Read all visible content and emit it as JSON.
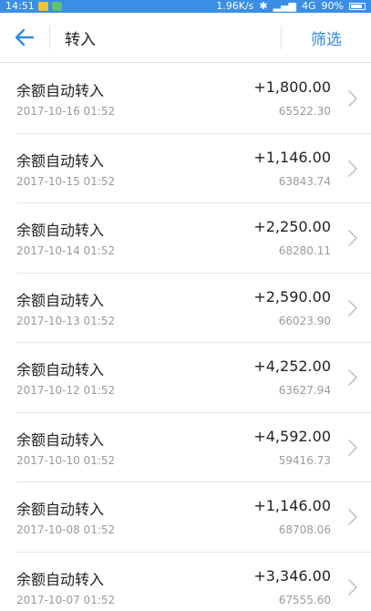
{
  "status_bar": {
    "time": "14:51",
    "net_speed": "1.96K/s",
    "network": "4G",
    "battery": "90%"
  },
  "header": {
    "title": "转入",
    "filter_label": "筛选"
  },
  "colors": {
    "accent": "#2f8ae6",
    "text": "#222222",
    "muted": "#9a9a9a"
  },
  "transactions": [
    {
      "title": "余额自动转入",
      "date": "2017-10-16 01:52",
      "amount": "+1,800.00",
      "balance": "65522.30"
    },
    {
      "title": "余额自动转入",
      "date": "2017-10-15 01:52",
      "amount": "+1,146.00",
      "balance": "63843.74"
    },
    {
      "title": "余额自动转入",
      "date": "2017-10-14 01:52",
      "amount": "+2,250.00",
      "balance": "68280.11"
    },
    {
      "title": "余额自动转入",
      "date": "2017-10-13 01:52",
      "amount": "+2,590.00",
      "balance": "66023.90"
    },
    {
      "title": "余额自动转入",
      "date": "2017-10-12 01:52",
      "amount": "+4,252.00",
      "balance": "63627.94"
    },
    {
      "title": "余额自动转入",
      "date": "2017-10-10 01:52",
      "amount": "+4,592.00",
      "balance": "59416.73"
    },
    {
      "title": "余额自动转入",
      "date": "2017-10-08 01:52",
      "amount": "+1,146.00",
      "balance": "68708.06"
    },
    {
      "title": "余额自动转入",
      "date": "2017-10-07 01:52",
      "amount": "+3,346.00",
      "balance": "67555.60"
    }
  ]
}
